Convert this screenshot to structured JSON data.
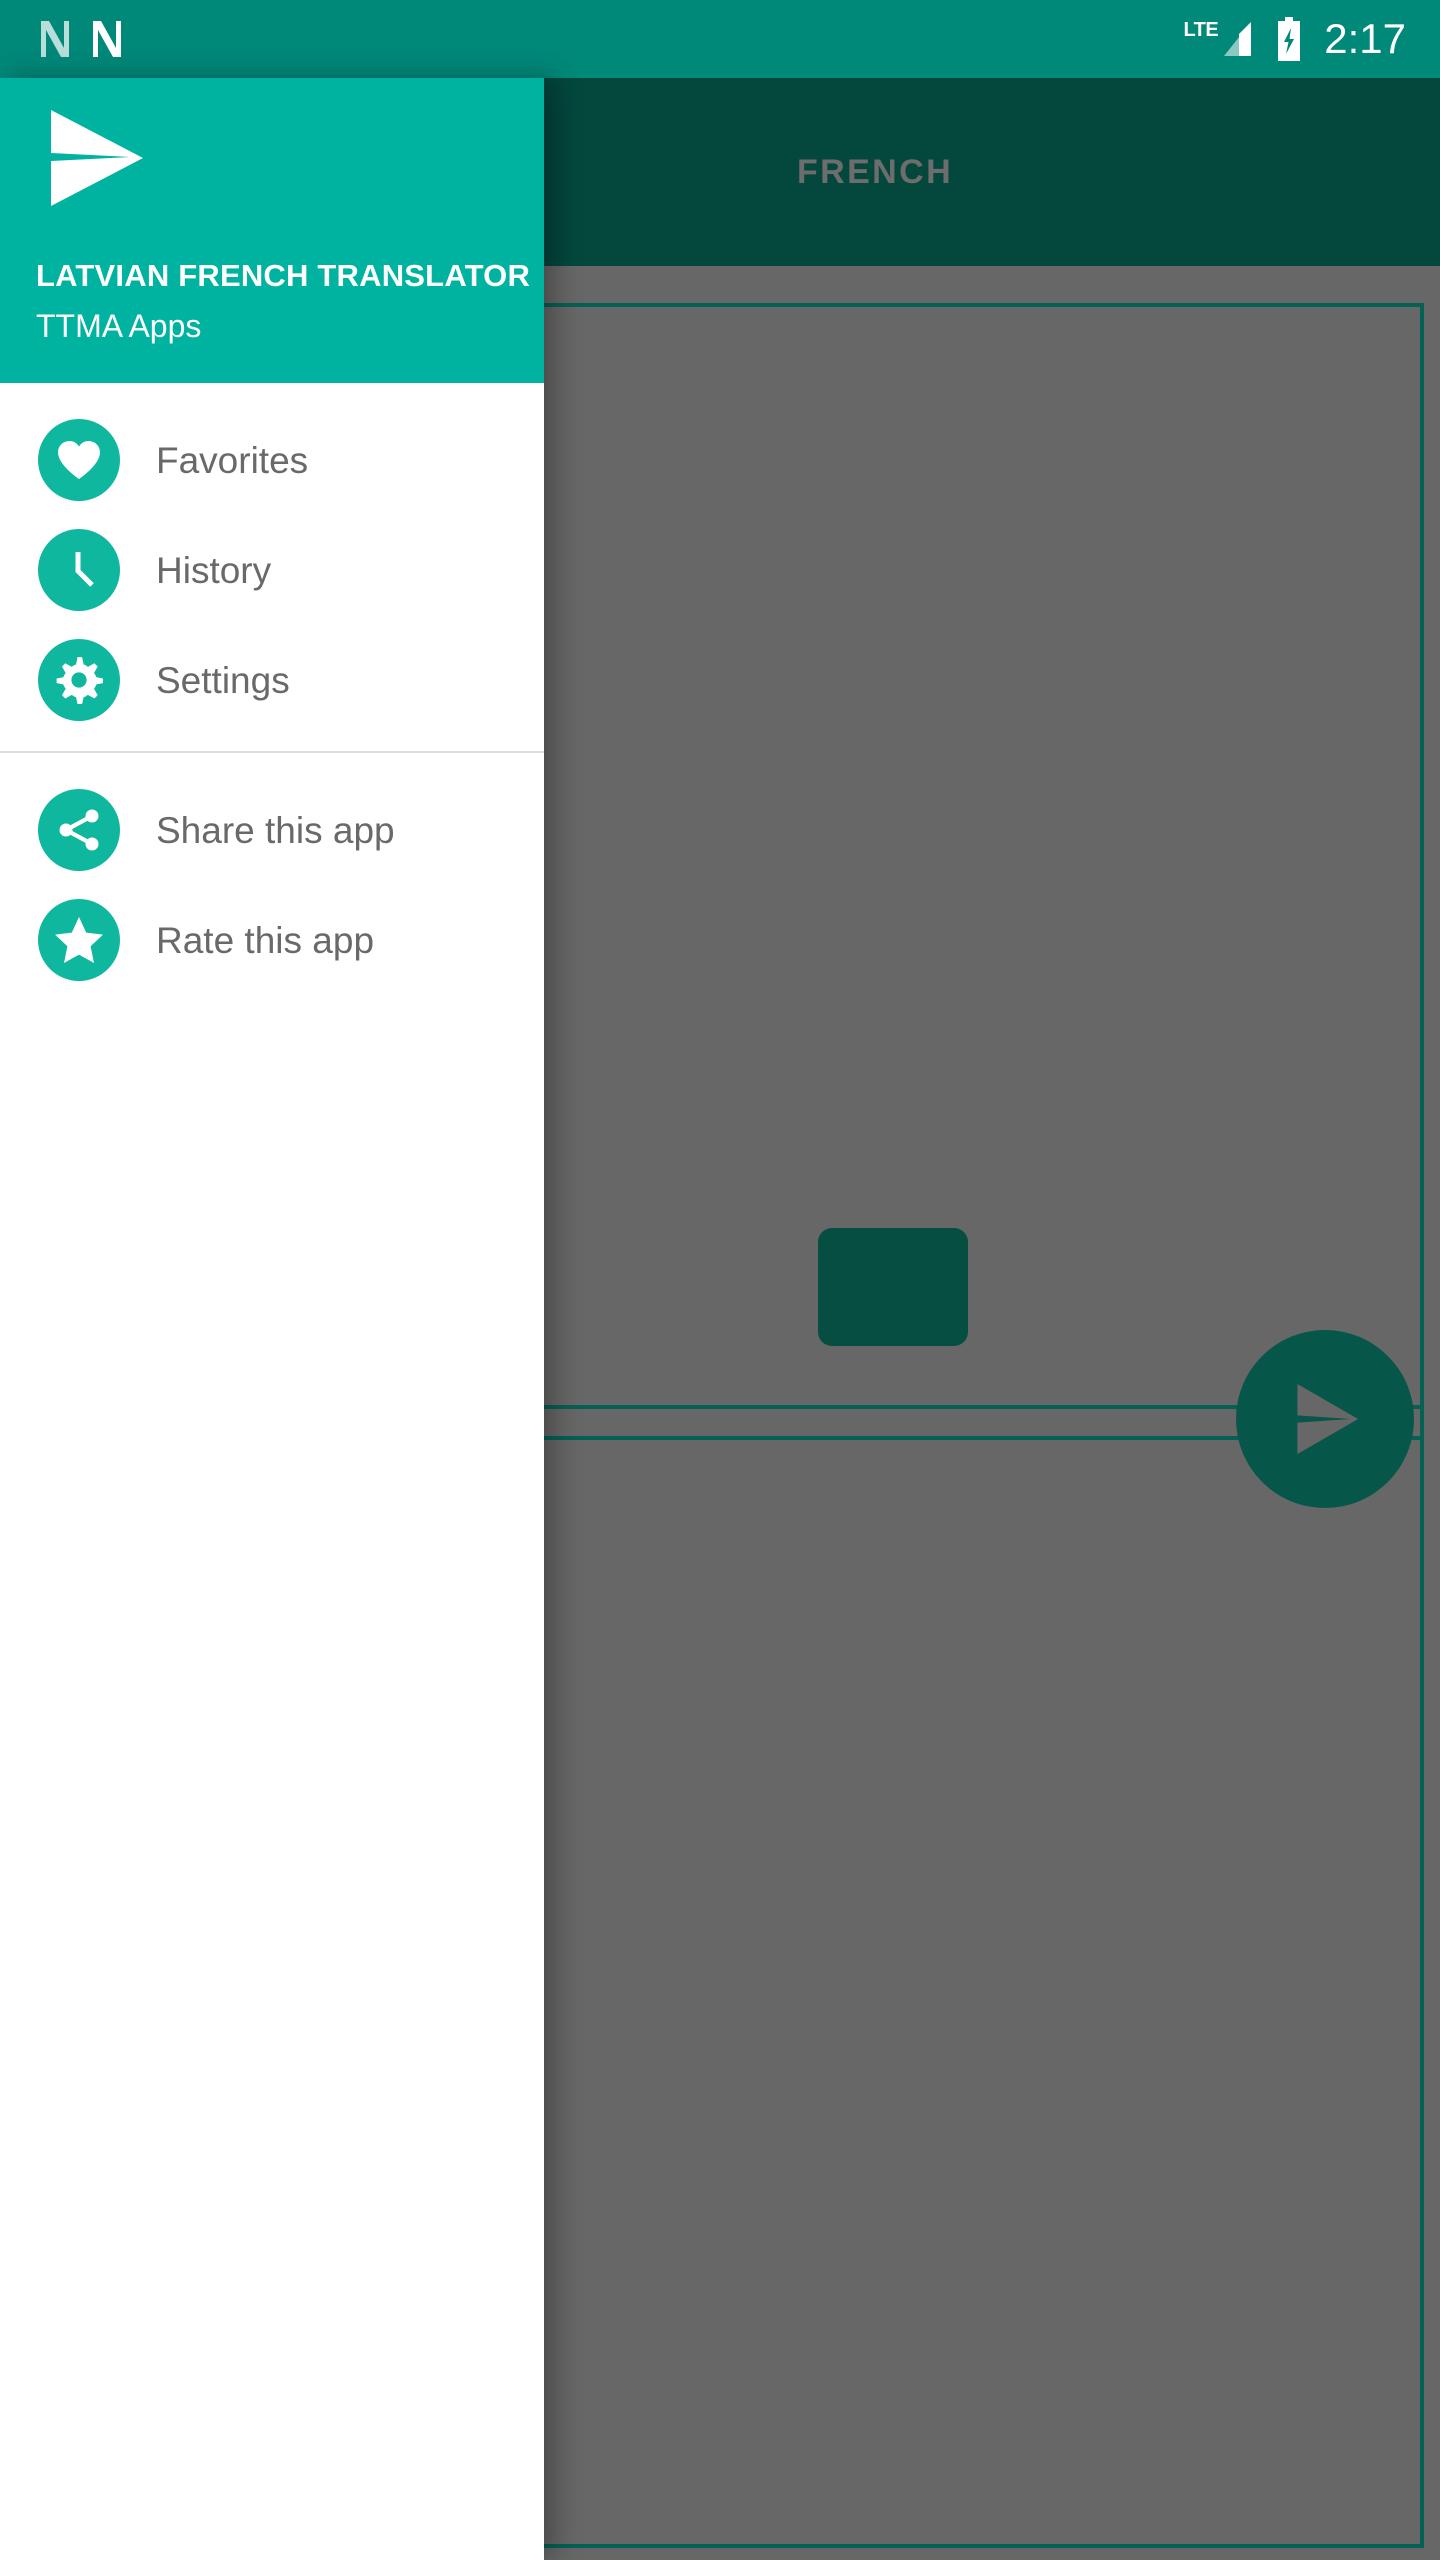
{
  "status_bar": {
    "notification_icons": [
      "android-n-icon",
      "android-n-icon"
    ],
    "network_label": "LTE",
    "signal_icon": "signal-bars-icon",
    "battery_icon": "battery-charging-icon",
    "time": "2:17",
    "background_color": "#008879"
  },
  "drawer": {
    "logo_icon": "send-arrow-logo",
    "title": "LATVIAN FRENCH TRANSLATOR",
    "subtitle": "TTMA Apps",
    "header_color": "#00b3a0",
    "icon_circle_color": "#0fb79f",
    "label_color": "#696969",
    "groups": [
      {
        "items": [
          {
            "label": "Favorites",
            "icon": "heart-icon"
          },
          {
            "label": "History",
            "icon": "clock-icon"
          },
          {
            "label": "Settings",
            "icon": "gear-icon"
          }
        ]
      },
      {
        "items": [
          {
            "label": "Share this app",
            "icon": "share-icon"
          },
          {
            "label": "Rate this app",
            "icon": "star-icon"
          }
        ]
      }
    ]
  },
  "background_app": {
    "toolbar_color": "#03473d",
    "scrim_color": "#676767",
    "accent_color": "#056154",
    "tabs": [
      {
        "label": "FRENCH",
        "selected": true
      }
    ],
    "fab": {
      "icon": "send-arrow-icon",
      "color": "#065749"
    }
  }
}
